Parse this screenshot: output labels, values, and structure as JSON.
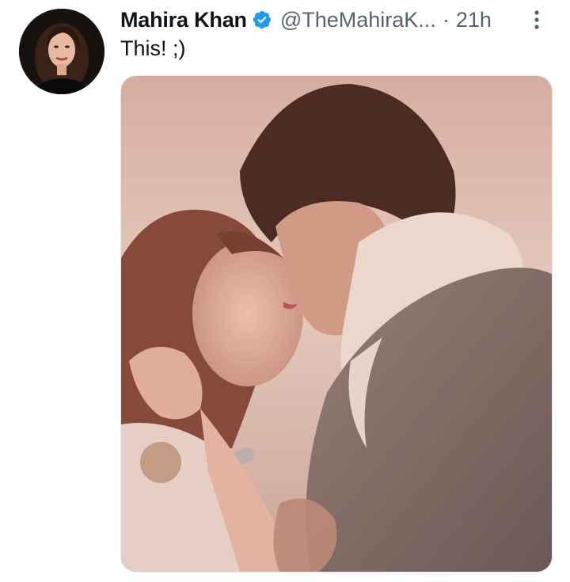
{
  "tweet": {
    "author_name": "Mahira Khan",
    "handle": "@TheMahiraK...",
    "separator": "·",
    "time": "21h",
    "text": "This! ;)",
    "icons": {
      "verified": "verified-badge-icon",
      "more": "more-options-icon"
    },
    "colors": {
      "name": "#0f1419",
      "secondary": "#536471",
      "verified": "#1d9bf0"
    }
  }
}
